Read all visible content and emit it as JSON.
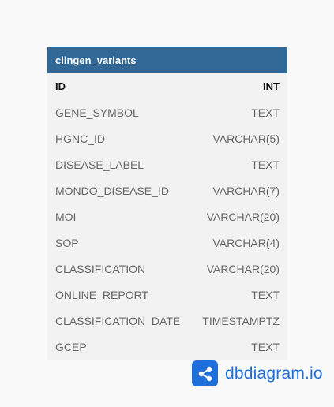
{
  "table": {
    "name": "clingen_variants",
    "fields": [
      {
        "name": "ID",
        "type": "INT",
        "primary": true
      },
      {
        "name": "GENE_SYMBOL",
        "type": "TEXT"
      },
      {
        "name": "HGNC_ID",
        "type": "VARCHAR(5)"
      },
      {
        "name": "DISEASE_LABEL",
        "type": "TEXT"
      },
      {
        "name": "MONDO_DISEASE_ID",
        "type": "VARCHAR(7)"
      },
      {
        "name": "MOI",
        "type": "VARCHAR(20)"
      },
      {
        "name": "SOP",
        "type": "VARCHAR(4)"
      },
      {
        "name": "CLASSIFICATION",
        "type": "VARCHAR(20)"
      },
      {
        "name": "ONLINE_REPORT",
        "type": "TEXT"
      },
      {
        "name": "CLASSIFICATION_DATE",
        "type": "TIMESTAMPTZ"
      },
      {
        "name": "GCEP",
        "type": "TEXT"
      }
    ]
  },
  "brand": {
    "name": "dbdiagram.io",
    "icon": "share-nodes-icon",
    "color": "#1e6fd9"
  },
  "colors": {
    "header": "#316896",
    "body": "#f2f2f2",
    "background": "#f9f9f9"
  }
}
